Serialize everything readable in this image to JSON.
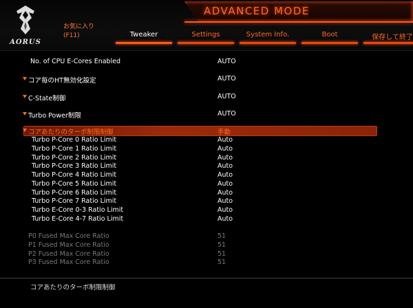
{
  "header": {
    "brand_text": "AORUS",
    "mode_title": "ADVANCED MODE",
    "favorites_label": "お気に入り",
    "favorites_key": "(F11)",
    "tabs": [
      {
        "label": "Tweaker",
        "active": true
      },
      {
        "label": "Settings",
        "active": false
      },
      {
        "label": "System Info.",
        "active": false
      },
      {
        "label": "Boot",
        "active": false
      },
      {
        "label": "保存して終了",
        "active": false
      }
    ]
  },
  "settings": [
    {
      "label": "No. of CPU E-Cores Enabled",
      "value": "AUTO"
    },
    {
      "label": "コア毎のHT無効化設定",
      "value": "AUTO",
      "expandable": true
    },
    {
      "label": "C-State制御",
      "value": "AUTO",
      "expandable": true
    },
    {
      "label": "Turbo Power制限",
      "value": "AUTO",
      "expandable": true
    },
    {
      "label": "コアあたりのターボ制限制御",
      "value": "手動",
      "expandable": true,
      "selected": true
    },
    {
      "label": "Turbo P-Core 0 Ratio Limit",
      "value": "Auto"
    },
    {
      "label": "Turbo P-Core 1 Ratio Limit",
      "value": "Auto"
    },
    {
      "label": "Turbo P-Core 2 Ratio Limit",
      "value": "Auto"
    },
    {
      "label": "Turbo P-Core 3 Ratio Limit",
      "value": "Auto"
    },
    {
      "label": "Turbo P-Core 4 Ratio Limit",
      "value": "Auto"
    },
    {
      "label": "Turbo P-Core 5 Ratio Limit",
      "value": "Auto"
    },
    {
      "label": "Turbo P-Core 6 Ratio Limit",
      "value": "Auto"
    },
    {
      "label": "Turbo P-Core 7 Ratio Limit",
      "value": "Auto"
    },
    {
      "label": "Turbo E-Core 0-3 Ratio Limit",
      "value": "Auto"
    },
    {
      "label": "Turbo E-Core 4-7 Ratio Limit",
      "value": "Auto"
    },
    {
      "label": "P0 Fused Max Core Ratio",
      "value": "51",
      "readonly": true
    },
    {
      "label": "P1 Fused Max Core Ratio",
      "value": "51",
      "readonly": true
    },
    {
      "label": "P2 Fused Max Core Ratio",
      "value": "51",
      "readonly": true
    },
    {
      "label": "P3 Fused Max Core Ratio",
      "value": "51",
      "readonly": true
    }
  ],
  "help_text": "コアあたりのターボ制限制御",
  "colors": {
    "accent": "#ff6a20",
    "highlight": "#9a2a0a",
    "readonly": "#7a7a7a"
  },
  "icons": {
    "logo": "aorus-eagle-icon",
    "expand": "triangle-down-icon"
  }
}
